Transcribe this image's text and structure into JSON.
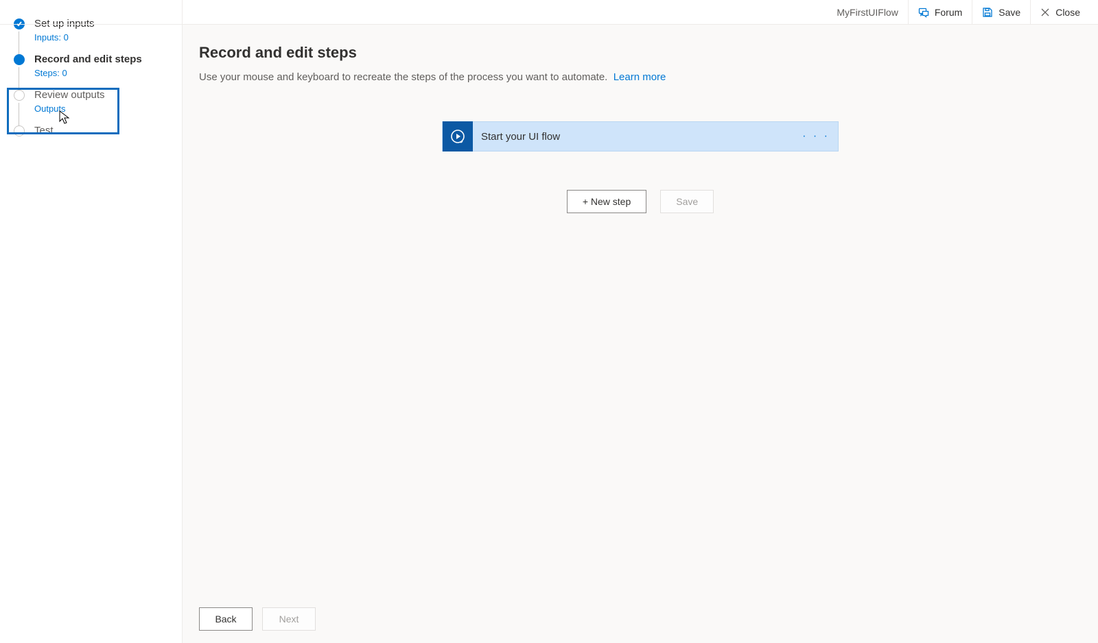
{
  "topbar": {
    "flow_name": "MyFirstUIFlow",
    "forum": "Forum",
    "save": "Save",
    "close": "Close"
  },
  "sidebar": {
    "steps": [
      {
        "title": "Set up inputs",
        "sub": "Inputs: 0"
      },
      {
        "title": "Record and edit steps",
        "sub": "Steps: 0"
      },
      {
        "title": "Review outputs",
        "sub": "Outputs"
      },
      {
        "title": "Test",
        "sub": ""
      }
    ]
  },
  "main": {
    "heading": "Record and edit steps",
    "description": "Use your mouse and keyboard to recreate the steps of the process you want to automate.",
    "learn_more": "Learn more"
  },
  "flow_card": {
    "title": "Start your UI flow"
  },
  "actions": {
    "new_step": "+ New step",
    "save": "Save"
  },
  "footer": {
    "back": "Back",
    "next": "Next"
  }
}
